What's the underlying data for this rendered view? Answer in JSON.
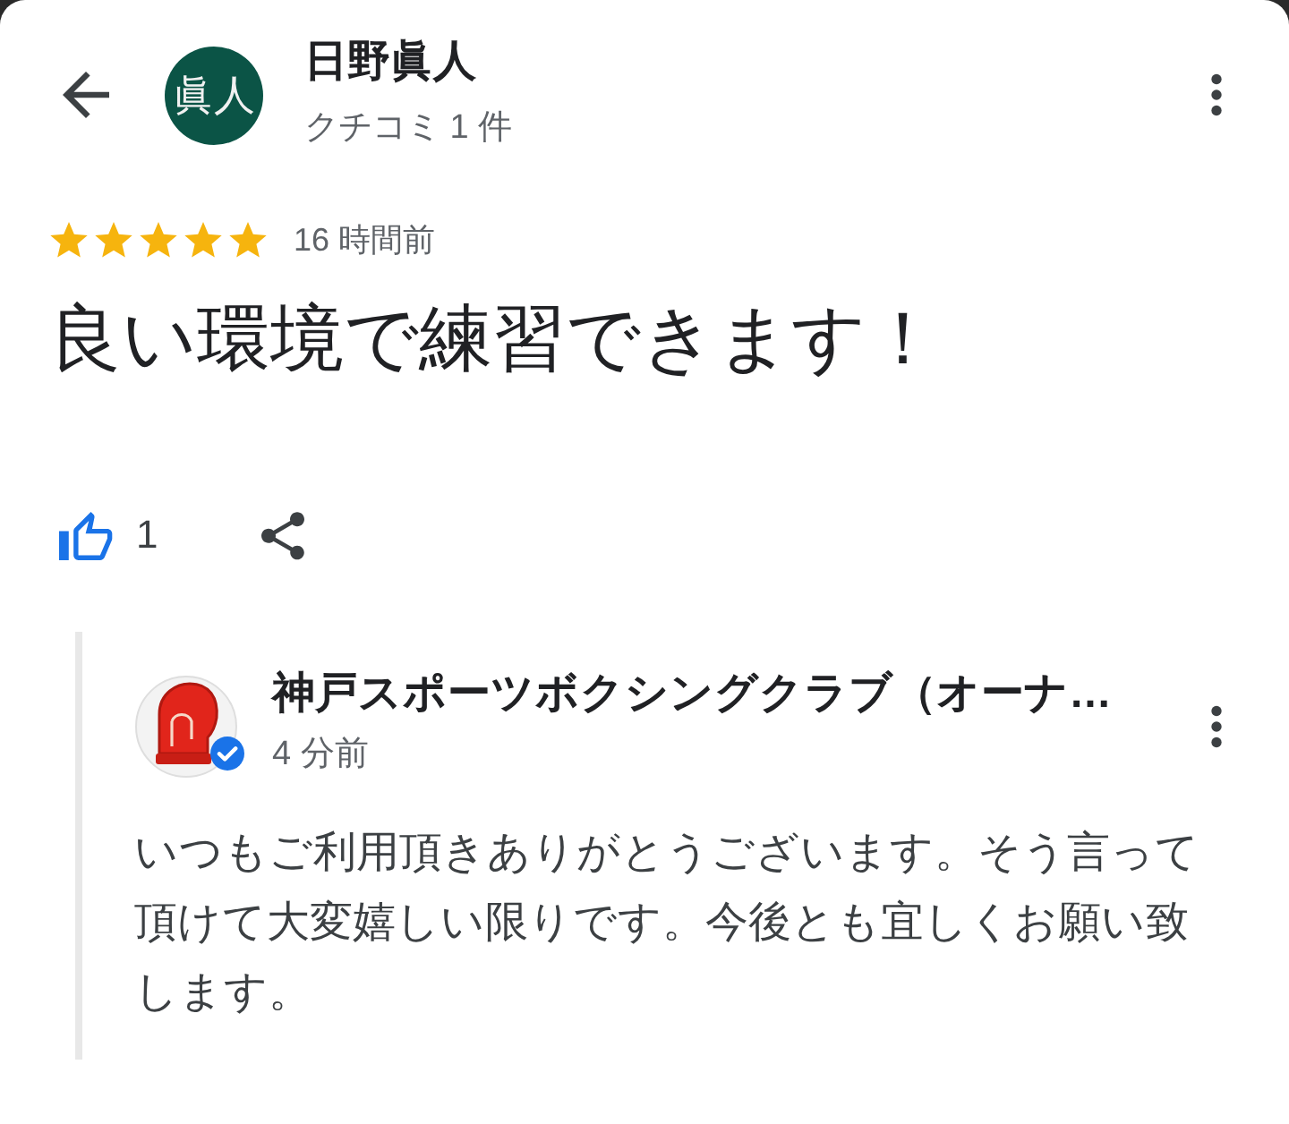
{
  "header": {
    "reviewer_initials": "眞人",
    "reviewer_name": "日野眞人",
    "review_count": "クチコミ 1 件"
  },
  "review": {
    "stars": 5,
    "time": "16 時間前",
    "text": "良い環境で練習できます！"
  },
  "actions": {
    "liked": true,
    "like_count": "1"
  },
  "owner_reply": {
    "name": "神戸スポーツボクシングクラブ（オーナ…",
    "verified": true,
    "time": "4 分前",
    "text": "いつもご利用頂きありがとうございます。そう言って頂けて大変嬉しい限りです。今後とも宜しくお願い致します。"
  }
}
